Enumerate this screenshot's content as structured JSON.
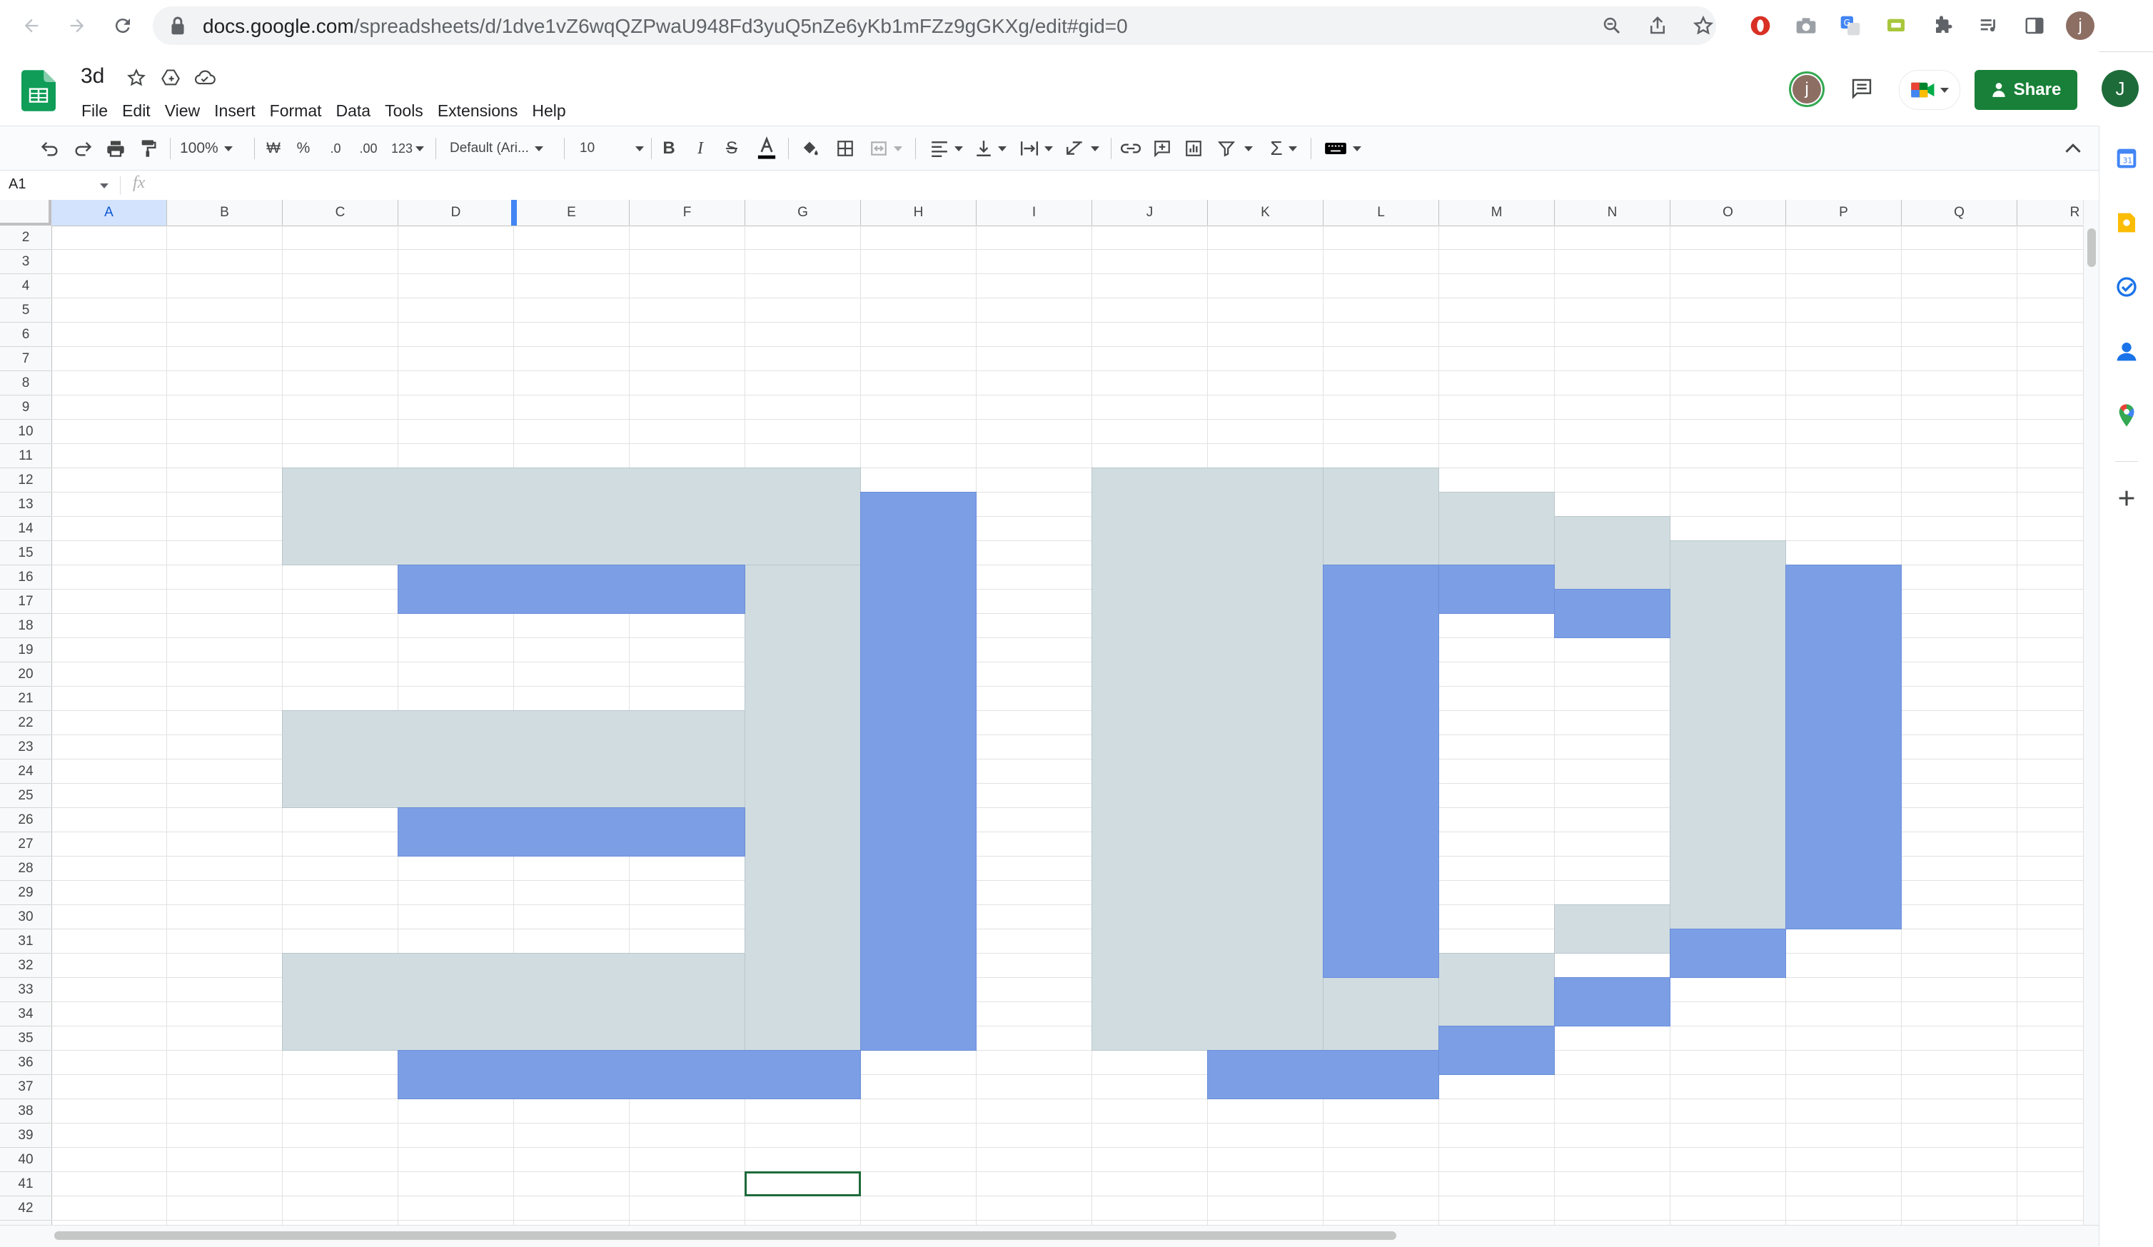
{
  "browser": {
    "url_host": "docs.google.com",
    "url_path": "/spreadsheets/d/1dve1vZ6wqQZPwaU948Fd3yuQ5nZe6yKb1mFZz9gGKXg/edit#gid=0",
    "profile_initial": "j"
  },
  "doc": {
    "title": "3d",
    "menu": [
      "File",
      "Edit",
      "View",
      "Insert",
      "Format",
      "Data",
      "Tools",
      "Extensions",
      "Help"
    ],
    "share_label": "Share",
    "user_avatar_initial": "j",
    "account_initial": "J"
  },
  "toolbar": {
    "zoom": "100%",
    "currency": "₩",
    "percent": "%",
    "dec_decrease": ".0",
    "dec_increase": ".00",
    "more_formats": "123",
    "font": "Default (Ari...",
    "font_size": "10"
  },
  "formula_bar": {
    "cell_ref": "A1",
    "fx": "fx"
  },
  "grid": {
    "columns": [
      "A",
      "B",
      "C",
      "D",
      "E",
      "F",
      "G",
      "H",
      "I",
      "J",
      "K",
      "L",
      "M",
      "N",
      "O",
      "P",
      "Q",
      "R"
    ],
    "first_row": 2,
    "last_row": 42,
    "selected_column": "A",
    "active_cell": "G41"
  },
  "colors": {
    "gray_fill": "#d0dce0",
    "blue_fill": "#7b9ee5",
    "share_green": "#188038"
  }
}
